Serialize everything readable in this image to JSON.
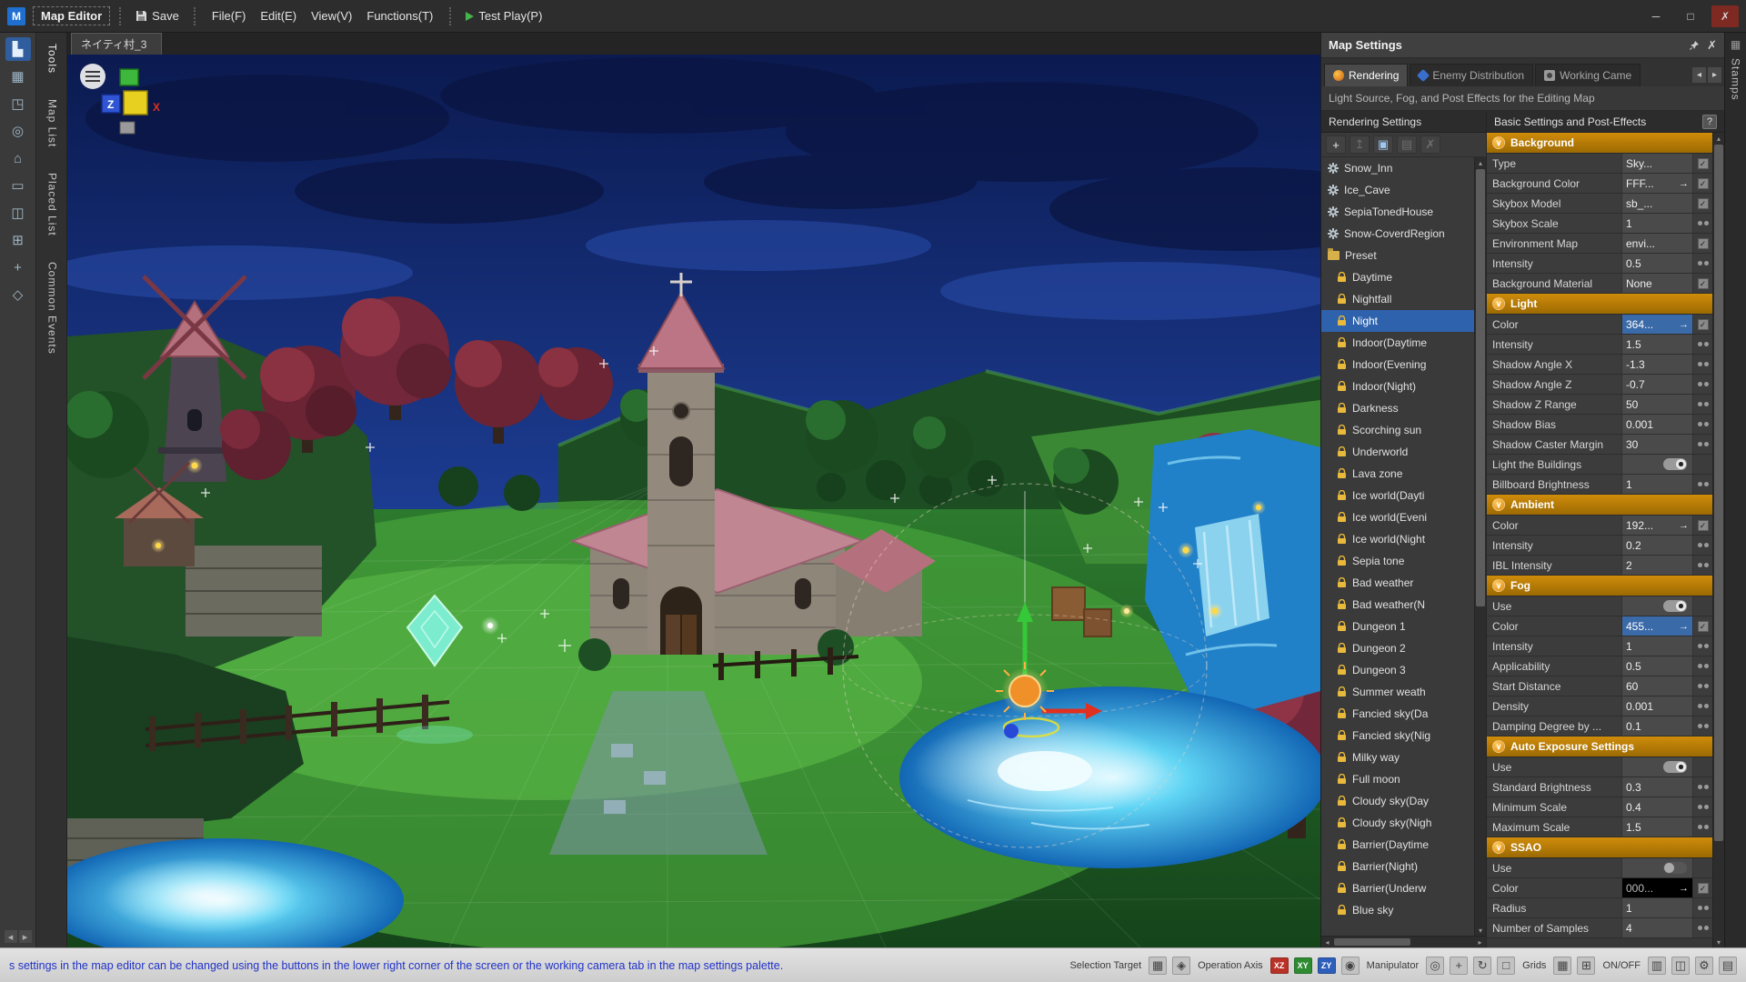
{
  "menubar": {
    "logo": "M",
    "title": "Map Editor",
    "save": "Save",
    "menus": [
      "File(F)",
      "Edit(E)",
      "View(V)",
      "Functions(T)"
    ],
    "test_play": "Test Play(P)",
    "window": {
      "minimize": "─",
      "maximize": "□",
      "close": "✗"
    }
  },
  "side_tabs": [
    "Tools",
    "Map List",
    "Placed List",
    "Common Events"
  ],
  "tool_icons": [
    {
      "name": "select-tool-icon",
      "glyph": "▙",
      "selected": true
    },
    {
      "name": "stamp-tool-icon",
      "glyph": "▦"
    },
    {
      "name": "terrain-tool-icon",
      "glyph": "◳"
    },
    {
      "name": "circle-tool-icon",
      "glyph": "◎"
    },
    {
      "name": "building-tool-icon",
      "glyph": "⌂"
    },
    {
      "name": "slab-tool-icon",
      "glyph": "▭"
    },
    {
      "name": "wall-tool-icon",
      "glyph": "◫"
    },
    {
      "name": "grid-tool-icon",
      "glyph": "⊞"
    },
    {
      "name": "add-object-tool-icon",
      "glyph": "+"
    },
    {
      "name": "gem-tool-icon",
      "glyph": "◇"
    }
  ],
  "viewport": {
    "tab": "ネイティ村_3",
    "gizmo": {
      "z": "Z",
      "x": "X"
    }
  },
  "stamps_tab": "Stamps",
  "rs_toolbar": [
    {
      "name": "add-rendering-setting-button",
      "glyph": "+",
      "enabled": true
    },
    {
      "name": "import-rendering-setting-button",
      "glyph": "↥"
    },
    {
      "name": "copy-rendering-setting-button",
      "glyph": "▣",
      "enabled": true,
      "accent": true
    },
    {
      "name": "export-rendering-setting-button",
      "glyph": "▤"
    },
    {
      "name": "delete-rendering-setting-button",
      "glyph": "✗"
    }
  ],
  "map_settings": {
    "title": "Map Settings",
    "tabs": [
      {
        "label": "Rendering",
        "selected": true
      },
      {
        "label": "Enemy Distribution"
      },
      {
        "label": "Working Came"
      }
    ],
    "description": "Light Source, Fog, and Post Effects for the Editing Map",
    "rendering_settings": {
      "header": "Rendering Settings",
      "maps": [
        "Snow_Inn",
        "Ice_Cave",
        "SepiaTonedHouse",
        "Snow-CoverdRegion"
      ],
      "folder": "Preset",
      "presets": [
        {
          "label": "Daytime"
        },
        {
          "label": "Nightfall"
        },
        {
          "label": "Night",
          "selected": true
        },
        {
          "label": "Indoor(Daytime"
        },
        {
          "label": "Indoor(Evening"
        },
        {
          "label": "Indoor(Night)"
        },
        {
          "label": "Darkness"
        },
        {
          "label": "Scorching sun"
        },
        {
          "label": "Underworld"
        },
        {
          "label": "Lava zone"
        },
        {
          "label": "Ice world(Dayti"
        },
        {
          "label": "Ice world(Eveni"
        },
        {
          "label": "Ice world(Night"
        },
        {
          "label": "Sepia tone"
        },
        {
          "label": "Bad weather"
        },
        {
          "label": "Bad weather(N"
        },
        {
          "label": "Dungeon 1"
        },
        {
          "label": "Dungeon 2"
        },
        {
          "label": "Dungeon 3"
        },
        {
          "label": "Summer weath"
        },
        {
          "label": "Fancied sky(Da"
        },
        {
          "label": "Fancied sky(Nig"
        },
        {
          "label": "Milky way"
        },
        {
          "label": "Full moon"
        },
        {
          "label": "Cloudy sky(Day"
        },
        {
          "label": "Cloudy sky(Nigh"
        },
        {
          "label": "Barrier(Daytime"
        },
        {
          "label": "Barrier(Night)"
        },
        {
          "label": "Barrier(Underw"
        },
        {
          "label": "Blue sky"
        }
      ]
    },
    "properties": {
      "header": "Basic Settings and Post-Effects",
      "help": "?",
      "sections": [
        {
          "title": "Background",
          "rows": [
            {
              "label": "Type",
              "value": "Sky...",
              "control": "check"
            },
            {
              "label": "Background Color",
              "value": "FFF...",
              "arrow": true,
              "control": "check"
            },
            {
              "label": "Skybox Model",
              "value": "sb_...",
              "control": "check"
            },
            {
              "label": "Skybox Scale",
              "value": "1",
              "control": "spin"
            },
            {
              "label": "Environment Map",
              "value": "envi...",
              "control": "check"
            },
            {
              "label": "Intensity",
              "value": "0.5",
              "control": "spin"
            },
            {
              "label": "Background Material",
              "value": "None",
              "control": "check"
            }
          ]
        },
        {
          "title": "Light",
          "rows": [
            {
              "label": "Color",
              "value": "364...",
              "style": "blue",
              "arrow": true,
              "control": "check"
            },
            {
              "label": "Intensity",
              "value": "1.5",
              "control": "spin"
            },
            {
              "label": "Shadow Angle X",
              "value": "-1.3",
              "control": "spin"
            },
            {
              "label": "Shadow Angle Z",
              "value": "-0.7",
              "control": "spin"
            },
            {
              "label": "Shadow Z Range",
              "value": "50",
              "control": "spin"
            },
            {
              "label": "Shadow Bias",
              "value": "0.001",
              "control": "spin"
            },
            {
              "label": "Shadow Caster Margin",
              "value": "30",
              "control": "spin"
            },
            {
              "label": "Light the Buildings",
              "value": "",
              "control": "toggle-on"
            },
            {
              "label": "Billboard Brightness",
              "value": "1",
              "control": "spin"
            }
          ]
        },
        {
          "title": "Ambient",
          "rows": [
            {
              "label": "Color",
              "value": "192...",
              "arrow": true,
              "control": "check"
            },
            {
              "label": "Intensity",
              "value": "0.2",
              "control": "spin"
            },
            {
              "label": "IBL Intensity",
              "value": "2",
              "control": "spin"
            }
          ]
        },
        {
          "title": "Fog",
          "rows": [
            {
              "label": "Use",
              "value": "",
              "control": "toggle-on"
            },
            {
              "label": "Color",
              "value": "455...",
              "style": "blue",
              "arrow": true,
              "control": "check"
            },
            {
              "label": "Intensity",
              "value": "1",
              "control": "spin"
            },
            {
              "label": "Applicability",
              "value": "0.5",
              "control": "spin"
            },
            {
              "label": "Start Distance",
              "value": "60",
              "control": "spin"
            },
            {
              "label": "Density",
              "value": "0.001",
              "control": "spin"
            },
            {
              "label": "Damping Degree by ...",
              "value": "0.1",
              "control": "spin"
            }
          ]
        },
        {
          "title": "Auto Exposure Settings",
          "rows": [
            {
              "label": "Use",
              "value": "",
              "control": "toggle-on"
            },
            {
              "label": "Standard Brightness",
              "value": "0.3",
              "control": "spin"
            },
            {
              "label": "Minimum Scale",
              "value": "0.4",
              "control": "spin"
            },
            {
              "label": "Maximum Scale",
              "value": "1.5",
              "control": "spin"
            }
          ]
        },
        {
          "title": "SSAO",
          "rows": [
            {
              "label": "Use",
              "value": "",
              "control": "toggle-off"
            },
            {
              "label": "Color",
              "value": "000...",
              "style": "black",
              "arrow": true,
              "control": "check"
            },
            {
              "label": "Radius",
              "value": "1",
              "control": "spin"
            },
            {
              "label": "Number of Samples",
              "value": "4",
              "control": "spin"
            }
          ]
        }
      ]
    }
  },
  "statusbar": {
    "message": "s settings in the map editor can be changed using the buttons in the lower right corner of the screen or the working camera tab in the map settings palette.",
    "controls": [
      {
        "type": "label",
        "text": "Selection Target",
        "name": "selection-target-label",
        "interactable": false
      },
      {
        "type": "icon",
        "text": "▦",
        "name": "selection-terrain-button",
        "interactable": true
      },
      {
        "type": "icon",
        "text": "◈",
        "name": "selection-object-button",
        "interactable": true
      },
      {
        "type": "label",
        "text": "Operation Axis",
        "name": "operation-axis-label",
        "interactable": false
      },
      {
        "type": "axis",
        "text": "XZ",
        "color": "#b93227",
        "name": "axis-xz-button",
        "interactable": true
      },
      {
        "type": "axis",
        "text": "XY",
        "color": "#2e8b32",
        "name": "axis-xy-button",
        "interactable": true
      },
      {
        "type": "axis",
        "text": "ZY",
        "color": "#2d5fba",
        "name": "axis-zy-button",
        "interactable": true
      },
      {
        "type": "icon",
        "text": "◉",
        "name": "axis-mode-button",
        "interactable": true
      },
      {
        "type": "label",
        "text": "Manipulator",
        "name": "manipulator-label",
        "interactable": false
      },
      {
        "type": "icon",
        "text": "◎",
        "name": "manipulator-select-button",
        "interactable": true
      },
      {
        "type": "icon",
        "text": "+",
        "name": "manipulator-move-button",
        "interactable": true
      },
      {
        "type": "icon",
        "text": "↻",
        "name": "manipulator-rotate-button",
        "interactable": true
      },
      {
        "type": "icon",
        "text": "□",
        "name": "manipulator-scale-button",
        "interactable": true
      },
      {
        "type": "label",
        "text": "Grids",
        "name": "grids-label",
        "interactable": false
      },
      {
        "type": "icon",
        "text": "▦",
        "name": "grids-toggle-button",
        "interactable": true
      },
      {
        "type": "icon",
        "text": "⊞",
        "name": "grid-snap-button",
        "interactable": true
      },
      {
        "type": "label",
        "text": "ON/OFF",
        "name": "onoff-label",
        "interactable": false
      },
      {
        "type": "icon",
        "text": "▥",
        "name": "display-toggle-1-button",
        "interactable": true
      },
      {
        "type": "icon",
        "text": "◫",
        "name": "display-toggle-2-button",
        "interactable": true
      },
      {
        "type": "icon",
        "text": "⚙",
        "name": "settings-button",
        "interactable": true
      },
      {
        "type": "icon",
        "text": "▤",
        "name": "layers-button",
        "interactable": true
      }
    ]
  }
}
